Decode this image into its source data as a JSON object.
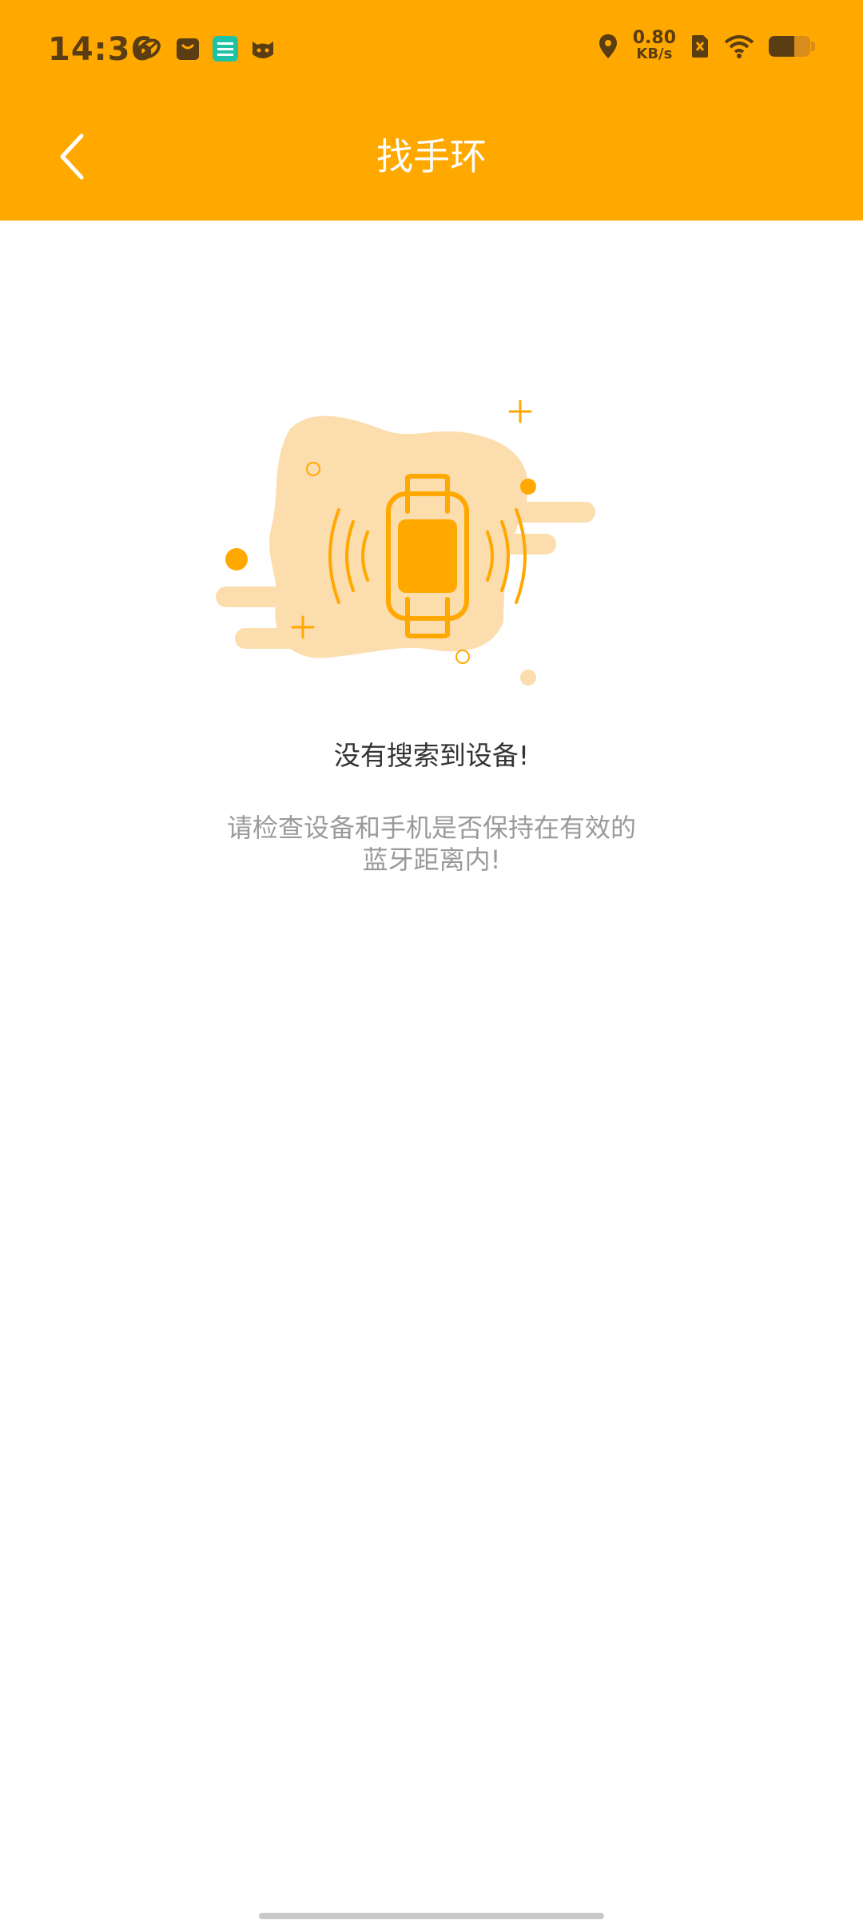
{
  "status_bar": {
    "time": "14:36",
    "net_speed_value": "0.80",
    "net_speed_unit": "KB/s",
    "battery_level": 0.62,
    "left_icons": [
      "basketball-icon",
      "shop-bag-icon",
      "green-app-icon",
      "cat-face-icon"
    ],
    "right_icons": [
      "location-icon",
      "sim-disabled-icon",
      "wifi-icon",
      "battery-icon"
    ]
  },
  "app_bar": {
    "title": "找手环",
    "back_icon": "chevron-left-icon"
  },
  "empty_state": {
    "title": "没有搜索到设备!",
    "description": "请检查设备和手机是否保持在有效的蓝牙距离内!",
    "illustration_icon": "smart-band-vibrating-icon"
  },
  "colors": {
    "accent": "#FFA800",
    "accent_light": "#FCDDAE",
    "status_text": "#5a3d12",
    "title_text": "#ffffff",
    "message_title": "#333333",
    "message_desc": "#9a9a9a"
  }
}
